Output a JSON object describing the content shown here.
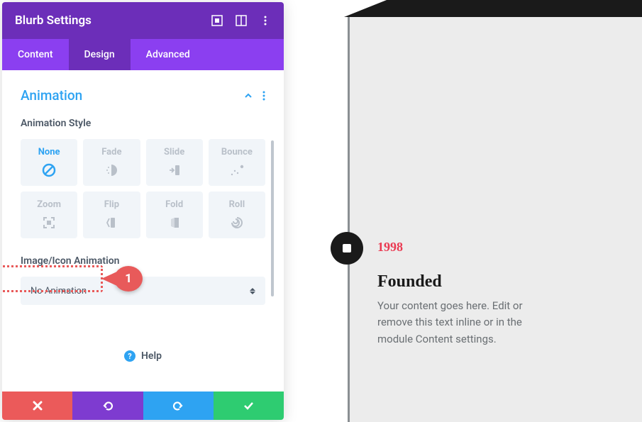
{
  "panel": {
    "title": "Blurb Settings",
    "tabs": [
      "Content",
      "Design",
      "Advanced"
    ],
    "active_tab": 1
  },
  "section": {
    "title": "Animation",
    "field_style_label": "Animation Style",
    "field_icon_label": "Image/Icon Animation",
    "select_value": "No Animation"
  },
  "anim_options": [
    {
      "label": "None",
      "icon": "ban",
      "active": true
    },
    {
      "label": "Fade",
      "icon": "fade",
      "active": false
    },
    {
      "label": "Slide",
      "icon": "slide",
      "active": false
    },
    {
      "label": "Bounce",
      "icon": "bounce",
      "active": false
    },
    {
      "label": "Zoom",
      "icon": "zoom",
      "active": false
    },
    {
      "label": "Flip",
      "icon": "flip",
      "active": false
    },
    {
      "label": "Fold",
      "icon": "fold",
      "active": false
    },
    {
      "label": "Roll",
      "icon": "roll",
      "active": false
    }
  ],
  "help": {
    "label": "Help"
  },
  "callout": {
    "number": "1"
  },
  "preview": {
    "year": "1998",
    "heading": "Founded",
    "body": "Your content goes here. Edit or remove this text inline or in the module Content settings."
  },
  "colors": {
    "purple_dark": "#6c2eb9",
    "purple_light": "#8b3ff0",
    "blue": "#2ea3f2",
    "red": "#eb5a5a",
    "green": "#2ecc71",
    "accent_red": "#ea3a52"
  }
}
